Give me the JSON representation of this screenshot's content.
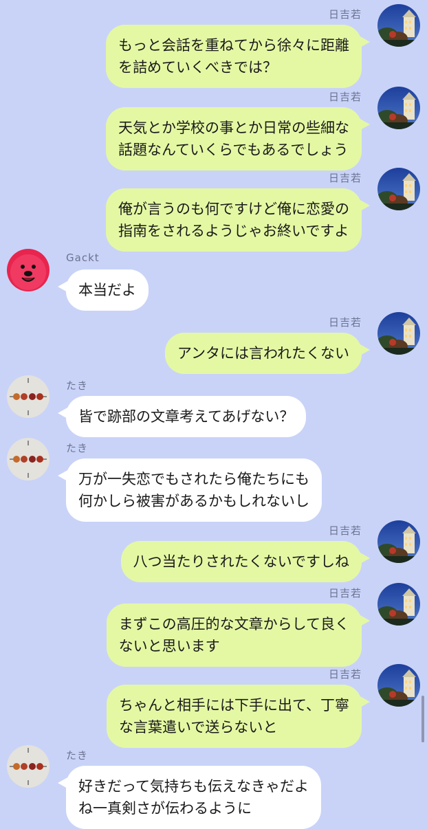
{
  "messages": [
    {
      "side": "right",
      "sender": "日吉若",
      "lines": [
        "もっと会話を重ねてから徐々に距離",
        "を詰めていくべきでは？"
      ],
      "avatar": "night-building-avatar"
    },
    {
      "side": "right",
      "sender": "日吉若",
      "lines": [
        "天気とか学校の事とか日常の些細な",
        "話題なんていくらでもあるでしょう"
      ],
      "avatar": "night-building-avatar"
    },
    {
      "side": "right",
      "sender": "日吉若",
      "lines": [
        "俺が言うのも何ですけど俺に恋愛の",
        "指南をされるようじゃお終いですよ"
      ],
      "avatar": "night-building-avatar"
    },
    {
      "side": "left",
      "sender": "Gackt",
      "lines": [
        "本当だよ"
      ],
      "avatar": "red-mascot-avatar"
    },
    {
      "side": "right",
      "sender": "日吉若",
      "lines": [
        "アンタには言われたくない"
      ],
      "avatar": "night-building-avatar"
    },
    {
      "side": "left",
      "sender": "たき",
      "lines": [
        "皆で跡部の文章考えてあげない？"
      ],
      "avatar": "fruit-clock-avatar"
    },
    {
      "side": "left",
      "sender": "たき",
      "lines": [
        "万が一失恋でもされたら俺たちにも",
        "何かしら被害があるかもしれないし"
      ],
      "avatar": "fruit-clock-avatar"
    },
    {
      "side": "right",
      "sender": "日吉若",
      "lines": [
        "八つ当たりされたくないですしね"
      ],
      "avatar": "night-building-avatar"
    },
    {
      "side": "right",
      "sender": "日吉若",
      "lines": [
        "まずこの高圧的な文章からして良く",
        "ないと思います"
      ],
      "avatar": "night-building-avatar"
    },
    {
      "side": "right",
      "sender": "日吉若",
      "lines": [
        "ちゃんと相手には下手に出て、丁寧",
        "な言葉遣いで送らないと"
      ],
      "avatar": "night-building-avatar"
    },
    {
      "side": "left",
      "sender": "たき",
      "lines": [
        "好きだって気持ちも伝えなきゃだよ",
        "ね一真剣さが伝わるように"
      ],
      "avatar": "fruit-clock-avatar"
    }
  ],
  "colors": {
    "background": "#c9d3f8",
    "outgoing_bubble": "#e4f8a4",
    "incoming_bubble": "#ffffff"
  }
}
